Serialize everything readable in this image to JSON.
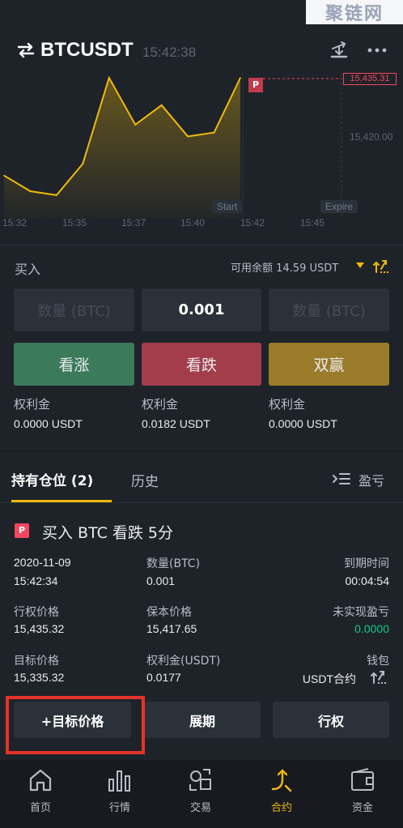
{
  "watermark": "聚链网",
  "header": {
    "symbol": "BTCUSDT",
    "time": "15:42:38"
  },
  "chart_data": {
    "type": "line",
    "x": [
      "15:31",
      "15:33",
      "15:35",
      "15:36",
      "15:37",
      "15:38",
      "15:39",
      "15:40",
      "15:41",
      "15:42"
    ],
    "values": [
      15415,
      15411,
      15410,
      15418,
      15440,
      15428,
      15433,
      15425,
      15426,
      15440
    ],
    "x_ticks": [
      "15:32",
      "15:35",
      "15:37",
      "15:40",
      "15:42",
      "15:45"
    ],
    "y_ticks": [
      "15,420.00"
    ],
    "current_price_label": "15,435.31",
    "start_label": "Start",
    "expire_label": "Expire",
    "marker": "P",
    "line_color": "#f0b90b"
  },
  "buy": {
    "label": "买入",
    "available": "可用余额 14.59 USDT",
    "qty_left_placeholder": "数量 (BTC)",
    "qty_value": "0.001",
    "qty_right_placeholder": "数量 (BTC)",
    "btn_up": "看涨",
    "btn_down": "看跌",
    "btn_win": "双赢",
    "premium_label": "权利金",
    "premium_up": "0.0000 USDT",
    "premium_down": "0.0182 USDT",
    "premium_win": "0.0000 USDT"
  },
  "tabs": {
    "positions": "持有仓位 (2)",
    "history": "历史",
    "pl": "盈亏"
  },
  "position": {
    "badge": "P",
    "title": "买入 BTC 看跌 5分",
    "date": "2020-11-09",
    "time": "15:42:34",
    "qty_label": "数量(BTC)",
    "qty": "0.001",
    "expiry_label": "到期时间",
    "expiry": "00:04:54",
    "strike_label": "行权价格",
    "strike": "15,435.32",
    "breakeven_label": "保本价格",
    "breakeven": "15,417.65",
    "upl_label": "未实现盈亏",
    "upl": "0.0000",
    "target_label": "目标价格",
    "target": "15,335.32",
    "premium_label": "权利金(USDT)",
    "premium": "0.0177",
    "wallet_label": "钱包",
    "wallet": "USDT合约",
    "btn_target": "+目标价格",
    "btn_extend": "展期",
    "btn_exercise": "行权"
  },
  "nav": [
    {
      "label": "首页",
      "icon": "home-icon"
    },
    {
      "label": "行情",
      "icon": "markets-icon"
    },
    {
      "label": "交易",
      "icon": "trade-icon"
    },
    {
      "label": "合约",
      "icon": "futures-icon",
      "active": true
    },
    {
      "label": "资金",
      "icon": "wallet-icon"
    }
  ]
}
